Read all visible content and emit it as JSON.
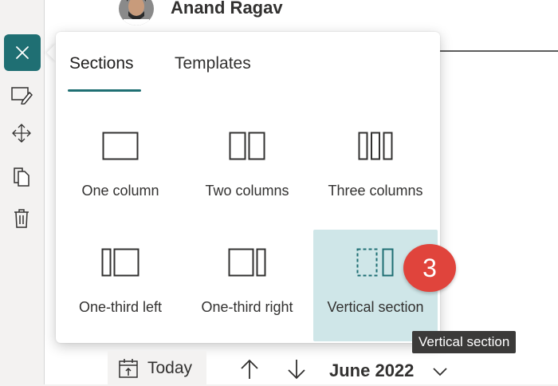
{
  "header": {
    "author_name": "Anand Ragav"
  },
  "rail": {
    "close_icon": "close-icon",
    "tools": [
      "edit-icon",
      "move-icon",
      "duplicate-icon",
      "delete-icon"
    ]
  },
  "popup": {
    "tabs": [
      {
        "label": "Sections",
        "selected": true
      },
      {
        "label": "Templates",
        "selected": false
      }
    ],
    "layouts": [
      {
        "label": "One column",
        "icon": "one-column-icon"
      },
      {
        "label": "Two columns",
        "icon": "two-columns-icon"
      },
      {
        "label": "Three columns",
        "icon": "three-columns-icon"
      },
      {
        "label": "One-third left",
        "icon": "one-third-left-icon"
      },
      {
        "label": "One-third right",
        "icon": "one-third-right-icon"
      },
      {
        "label": "Vertical section",
        "icon": "vertical-section-icon",
        "hovered": true
      }
    ]
  },
  "badge": {
    "number": "3"
  },
  "tooltip": {
    "text": "Vertical section"
  },
  "calendar": {
    "today_label": "Today",
    "month": "June 2022"
  },
  "colors": {
    "accent": "#1f6f73",
    "hover": "#cfe6e8",
    "badge": "#e0443c",
    "tooltip": "#3b3a39"
  }
}
